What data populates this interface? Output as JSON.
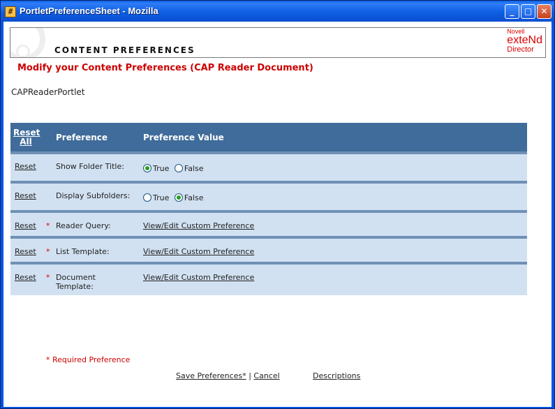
{
  "window": {
    "title": "PortletPreferenceSheet - Mozilla"
  },
  "banner": {
    "title": "CONTENT PREFERENCES",
    "logo": {
      "line1": "Novell",
      "line2": "exteNd",
      "line3": "Director"
    }
  },
  "heading": "Modify your Content Preferences (CAP Reader Document)",
  "portlet_name": "CAPReaderPortlet",
  "table": {
    "headers": {
      "reset_all_1": "Reset",
      "reset_all_2": "All",
      "preference": "Preference",
      "value": "Preference Value"
    },
    "rows": [
      {
        "reset": "Reset",
        "star": "",
        "label": "Show Folder Title:",
        "type": "radio",
        "options": [
          "True",
          "False"
        ],
        "selected": "True"
      },
      {
        "reset": "Reset",
        "star": "",
        "label": "Display Subfolders:",
        "type": "radio",
        "options": [
          "True",
          "False"
        ],
        "selected": "False"
      },
      {
        "reset": "Reset",
        "star": "*",
        "label": "Reader Query:",
        "type": "link",
        "link": "View/Edit Custom Preference"
      },
      {
        "reset": "Reset",
        "star": "*",
        "label": "List Template:",
        "type": "link",
        "link": "View/Edit Custom Preference"
      },
      {
        "reset": "Reset",
        "star": "*",
        "label1": "Document",
        "label2": "Template:",
        "type": "link",
        "link": "View/Edit Custom Preference"
      }
    ]
  },
  "required_note": "* Required Preference",
  "footer": {
    "save": "Save Preferences*",
    "sep": "|",
    "cancel": "Cancel",
    "descriptions": "Descriptions"
  }
}
